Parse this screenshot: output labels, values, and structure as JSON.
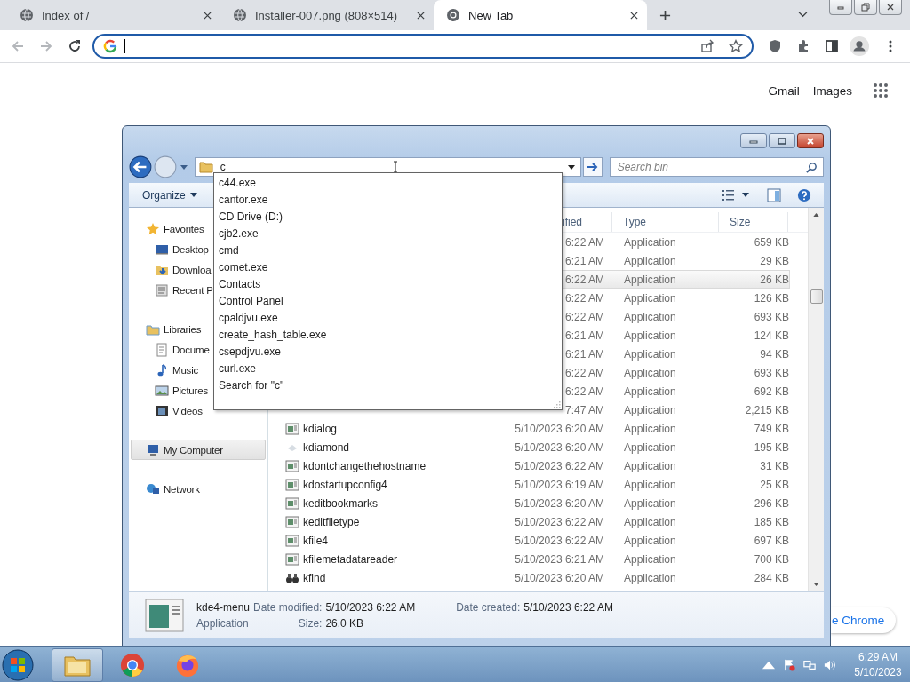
{
  "browser": {
    "tabs": [
      {
        "title": "Index of /",
        "kind": "globe",
        "selected": false
      },
      {
        "title": "Installer-007.png (808×514)",
        "kind": "globe",
        "selected": false
      },
      {
        "title": "New Tab",
        "kind": "chrome",
        "selected": true
      }
    ],
    "nav_buttons": [
      {
        "kind": "back",
        "disabled": true
      },
      {
        "kind": "forward",
        "disabled": true
      },
      {
        "kind": "reload",
        "disabled": false
      }
    ]
  },
  "page": {
    "links": [
      "Gmail",
      "Images"
    ],
    "customize_button": "e Chrome"
  },
  "explorer": {
    "address": {
      "value": "c"
    },
    "search": {
      "placeholder": "Search bin"
    },
    "organize": "Organize",
    "suggestions": [
      "c44.exe",
      "cantor.exe",
      "CD Drive (D:)",
      "cjb2.exe",
      "cmd",
      "comet.exe",
      "Contacts",
      "Control Panel",
      "cpaldjvu.exe",
      "create_hash_table.exe",
      "csepdjvu.exe",
      "curl.exe",
      "Search for \"c\""
    ],
    "nav": [
      {
        "label": "Favorites",
        "kind": "star",
        "selected": false,
        "children": [
          {
            "label": "Desktop",
            "kind": "desktop",
            "selected": false
          },
          {
            "label": "Downloa",
            "kind": "download",
            "selected": false
          },
          {
            "label": "Recent P",
            "kind": "recent",
            "selected": false
          }
        ]
      },
      {
        "label": "Libraries",
        "kind": "library",
        "selected": false,
        "children": [
          {
            "label": "Docume",
            "kind": "document",
            "selected": false
          },
          {
            "label": "Music",
            "kind": "music",
            "selected": false
          },
          {
            "label": "Pictures",
            "kind": "pictures",
            "selected": false
          },
          {
            "label": "Videos",
            "kind": "videos",
            "selected": false
          }
        ]
      },
      {
        "label": "My Computer",
        "kind": "computer",
        "selected": true
      },
      {
        "label": "Network",
        "kind": "network",
        "selected": false
      }
    ],
    "columns": [
      "ified",
      "Type",
      "Size"
    ],
    "rows": [
      {
        "modified": "6:22 AM",
        "type": "Application",
        "size": "659 KB",
        "selected": false
      },
      {
        "modified": "6:21 AM",
        "type": "Application",
        "size": "29 KB",
        "selected": false
      },
      {
        "modified": "6:22 AM",
        "type": "Application",
        "size": "26 KB",
        "selected": true
      },
      {
        "modified": "6:22 AM",
        "type": "Application",
        "size": "126 KB",
        "selected": false
      },
      {
        "modified": "6:22 AM",
        "type": "Application",
        "size": "693 KB",
        "selected": false
      },
      {
        "modified": "6:21 AM",
        "type": "Application",
        "size": "124 KB",
        "selected": false
      },
      {
        "modified": "6:21 AM",
        "type": "Application",
        "size": "94 KB",
        "selected": false
      },
      {
        "modified": "6:22 AM",
        "type": "Application",
        "size": "693 KB",
        "selected": false
      },
      {
        "modified": "6:22 AM",
        "type": "Application",
        "size": "692 KB",
        "selected": false
      },
      {
        "modified": "7:47 AM",
        "type": "Application",
        "size": "2,215 KB",
        "selected": false
      },
      {
        "name": "kdialog",
        "kind": "app",
        "modified": "5/10/2023 6:20 AM",
        "type": "Application",
        "size": "749 KB",
        "selected": false
      },
      {
        "name": "kdiamond",
        "kind": "diamond",
        "modified": "5/10/2023 6:20 AM",
        "type": "Application",
        "size": "195 KB",
        "selected": false
      },
      {
        "name": "kdontchangethehostname",
        "kind": "app",
        "modified": "5/10/2023 6:22 AM",
        "type": "Application",
        "size": "31 KB",
        "selected": false
      },
      {
        "name": "kdostartupconfig4",
        "kind": "app",
        "modified": "5/10/2023 6:19 AM",
        "type": "Application",
        "size": "25 KB",
        "selected": false
      },
      {
        "name": "keditbookmarks",
        "kind": "app",
        "modified": "5/10/2023 6:20 AM",
        "type": "Application",
        "size": "296 KB",
        "selected": false
      },
      {
        "name": "keditfiletype",
        "kind": "app",
        "modified": "5/10/2023 6:22 AM",
        "type": "Application",
        "size": "185 KB",
        "selected": false
      },
      {
        "name": "kfile4",
        "kind": "app",
        "modified": "5/10/2023 6:22 AM",
        "type": "Application",
        "size": "697 KB",
        "selected": false
      },
      {
        "name": "kfilemetadatareader",
        "kind": "app",
        "modified": "5/10/2023 6:21 AM",
        "type": "Application",
        "size": "700 KB",
        "selected": false
      },
      {
        "name": "kfind",
        "kind": "binoculars",
        "modified": "5/10/2023 6:20 AM",
        "type": "Application",
        "size": "284 KB",
        "selected": false
      }
    ],
    "details": {
      "name": "kde4-menu",
      "type": "Application",
      "fields": [
        {
          "label": "Date modified:",
          "value": "5/10/2023 6:22 AM"
        },
        {
          "label": "Size:",
          "value": "26.0 KB"
        },
        {
          "label": "Date created:",
          "value": "5/10/2023 6:22 AM"
        }
      ]
    }
  },
  "taskbar": {
    "apps": [
      {
        "kind": "explorer",
        "selected": true
      },
      {
        "kind": "chrome",
        "selected": false
      },
      {
        "kind": "firefox",
        "selected": false
      }
    ],
    "clock": {
      "time": "6:29 AM",
      "date": "5/10/2023"
    }
  }
}
